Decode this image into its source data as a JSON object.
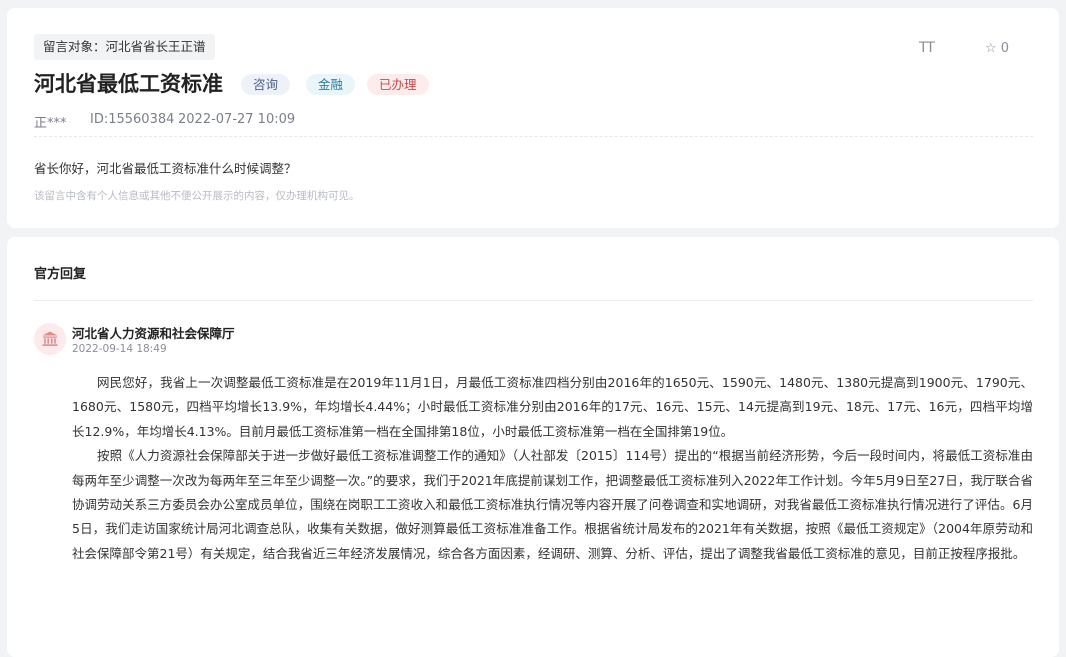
{
  "message": {
    "target_label": "留言对象：河北省省长王正谱",
    "title": "河北省最低工资标准",
    "tags": {
      "consult": "咨询",
      "finance": "金融",
      "status": "已办理"
    },
    "font_toggle_label": "TT",
    "favorite_count": "0",
    "author": "正***",
    "id_label": "ID:15560384",
    "time": "2022-07-27 10:09",
    "content": "省长你好，河北省最低工资标准什么时候调整？",
    "privacy_note": "该留言中含有个人信息或其他不便公开展示的内容，仅办理机构可见。"
  },
  "reply": {
    "heading": "官方回复",
    "org_name": "河北省人力资源和社会保障厅",
    "time": "2022-09-14 18:49",
    "paragraphs": [
      "网民您好，我省上一次调整最低工资标准是在2019年11月1日，月最低工资标准四档分别由2016年的1650元、1590元、1480元、1380元提高到1900元、1790元、1680元、1580元，四档平均增长13.9%，年均增长4.44%；小时最低工资标准分别由2016年的17元、16元、15元、14元提高到19元、18元、17元、16元，四档平均增长12.9%，年均增长4.13%。目前月最低工资标准第一档在全国排第18位，小时最低工资标准第一档在全国排第19位。",
      "按照《人力资源社会保障部关于进一步做好最低工资标准调整工作的通知》（人社部发〔2015〕114号）提出的“根据当前经济形势，今后一段时间内，将最低工资标准由每两年至少调整一次改为每两年至三年至少调整一次。”的要求，我们于2021年底提前谋划工作，把调整最低工资标准列入2022年工作计划。今年5月9日至27日，我厅联合省协调劳动关系三方委员会办公室成员单位，围绕在岗职工工资收入和最低工资标准执行情况等内容开展了问卷调查和实地调研，对我省最低工资标准执行情况进行了评估。6月5日，我们走访国家统计局河北调查总队，收集有关数据，做好测算最低工资标准准备工作。根据省统计局发布的2021年有关数据，按照《最低工资规定》（2004年原劳动和社会保障部令第21号）有关规定，结合我省近三年经济发展情况，综合各方面因素，经调研、测算、分析、评估，提出了调整我省最低工资标准的意见，目前正按程序报批。"
    ]
  },
  "icons": {
    "favorite": "star-outline-icon",
    "avatar": "government-building-icon"
  },
  "colors": {
    "status_red": "#d14848",
    "avatar_bg": "#fdeaea",
    "page_bg": "#f2f3f5"
  }
}
